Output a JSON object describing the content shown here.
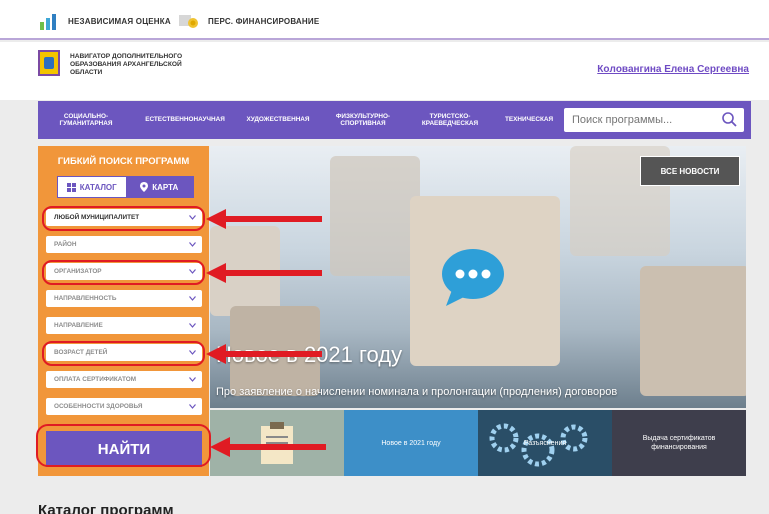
{
  "topbar": {
    "link1": "НЕЗАВИСИМАЯ ОЦЕНКА",
    "link2": "ПЕРС. ФИНАНСИРОВАНИЕ"
  },
  "header": {
    "title_line1": "НАВИГАТОР ДОПОЛНИТЕЛЬНОГО",
    "title_line2": "ОБРАЗОВАНИЯ АРХАНГЕЛЬСКОЙ",
    "title_line3": "ОБЛАСТИ",
    "user_name": "Кoлoвангина Елена Сергеевна"
  },
  "categories": [
    {
      "line1": "СОЦИАЛЬНО-",
      "line2": "ГУМАНИТАРНАЯ"
    },
    {
      "line1": "ЕСТЕСТВЕННОНАУЧНАЯ",
      "line2": ""
    },
    {
      "line1": "ХУДОЖЕСТВЕННАЯ",
      "line2": ""
    },
    {
      "line1": "ФИЗКУЛЬТУРНО-",
      "line2": "СПОРТИВНАЯ"
    },
    {
      "line1": "ТУРИСТСКО-",
      "line2": "КРАЕВЕДЧЕСКАЯ"
    },
    {
      "line1": "ТЕХНИЧЕСКАЯ",
      "line2": ""
    }
  ],
  "search": {
    "placeholder": "Поиск программы..."
  },
  "sidebar": {
    "title": "ГИБКИЙ ПОИСК ПРОГРАММ",
    "tab_catalog": "КАТАЛОГ",
    "tab_map": "КАРТА",
    "filters": [
      "ЛЮБОЙ МУНИЦИПАЛИТЕТ",
      "РАЙОН",
      "ОРГАНИЗАТОР",
      "НАПРАВЛЕННОСТЬ",
      "НАПРАВЛЕНИЕ",
      "ВОЗРАСТ ДЕТЕЙ",
      "ОПЛАТА СЕРТИФИКАТОМ",
      "ОСОБЕННОСТИ ЗДОРОВЬЯ"
    ],
    "find_button": "НАЙТИ"
  },
  "news": {
    "all_news": "ВСЕ НОВОСТИ",
    "headline": "Новое в 2021 году",
    "subtitle": "Про заявление о начислении номинала и пролонгации (продления) договоров",
    "thumbs": [
      "",
      "Новое в 2021 году",
      "Разъяснения",
      "Выдача сертификатов финансирования"
    ]
  },
  "catalog_heading": "Каталог программ",
  "colors": {
    "accent": "#6c56bf",
    "sidebar": "#f1963a",
    "annotation": "#e01b23"
  }
}
